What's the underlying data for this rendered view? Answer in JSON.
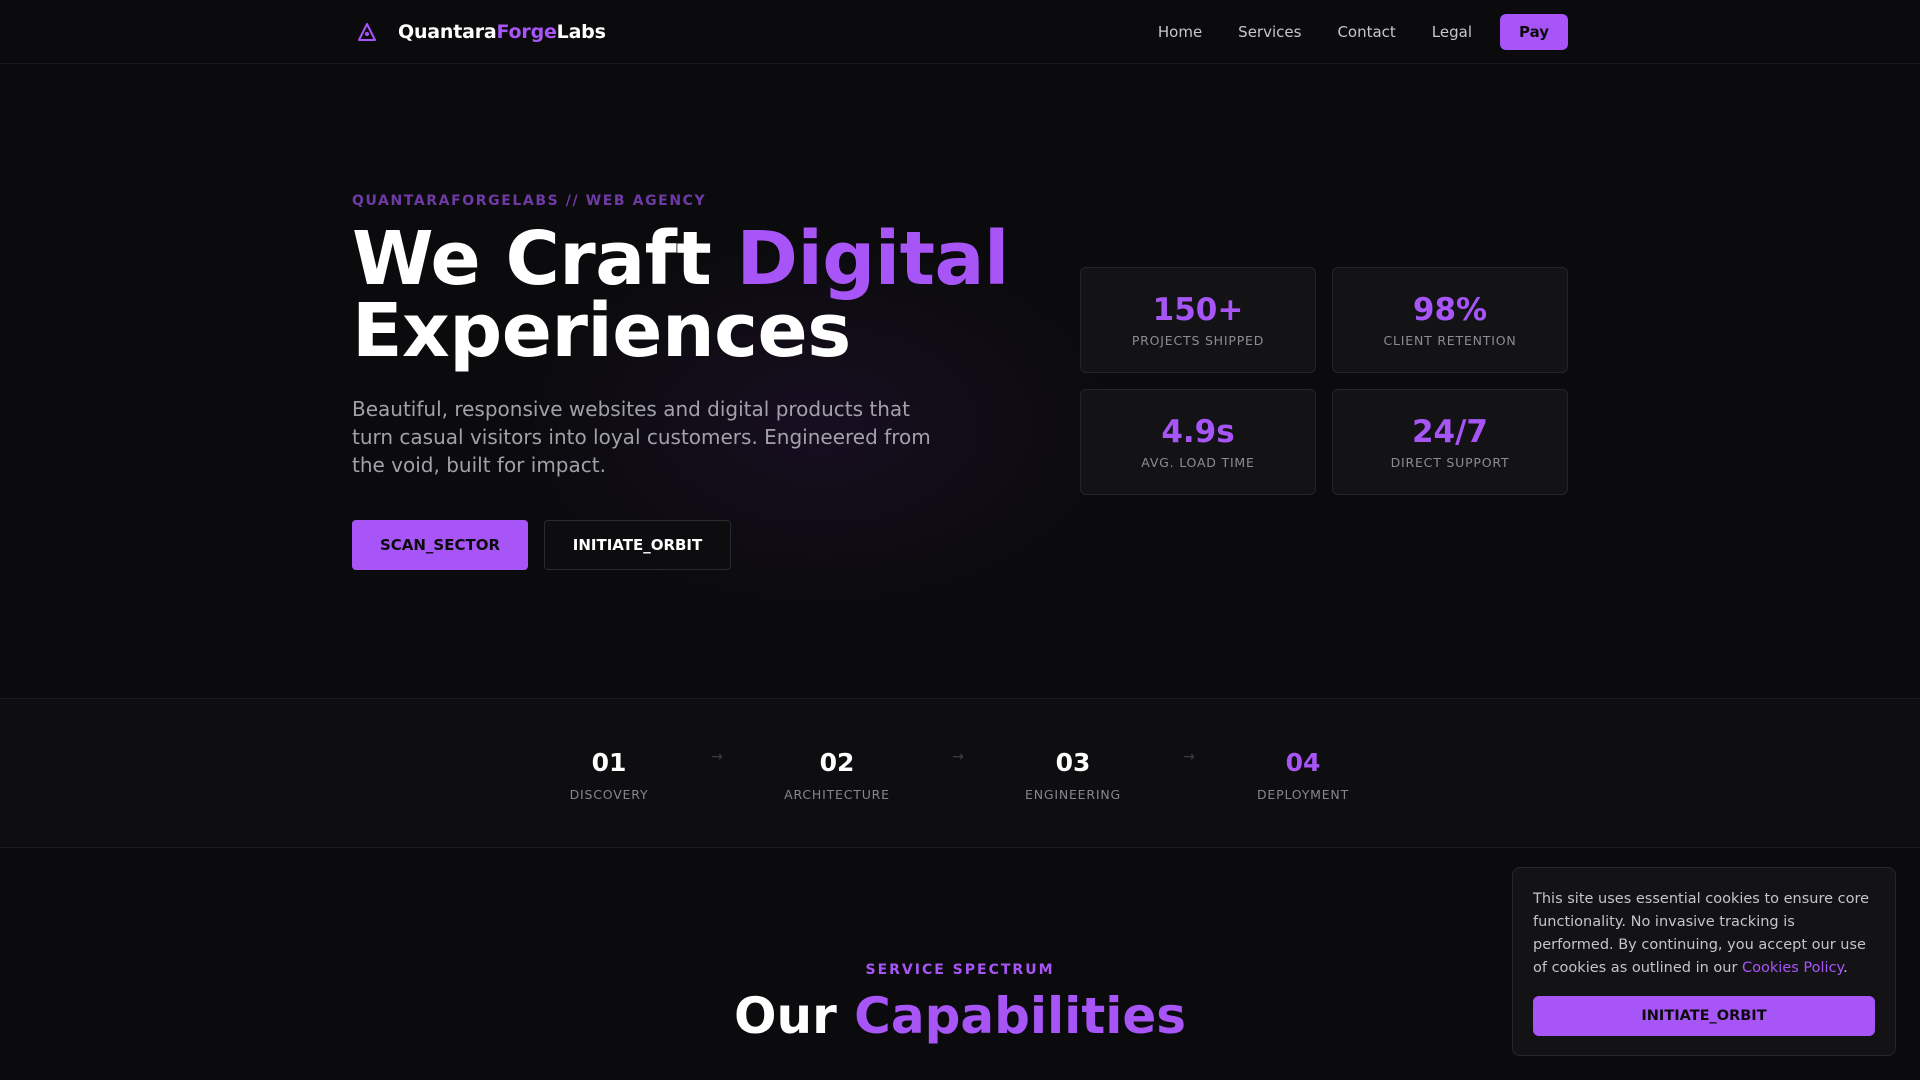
{
  "nav": {
    "brand": {
      "part1": "Quantara",
      "part2": "Forge",
      "part3": "Labs",
      "logo_icon": "triangle-logo-icon"
    },
    "links": [
      "Home",
      "Services",
      "Contact",
      "Legal"
    ],
    "cta_label": "Pay"
  },
  "hero": {
    "eyebrow": "QUANTARAFORGELABS // WEB AGENCY",
    "headline_line1_plain": "We Craft ",
    "headline_line1_accent": "Digital",
    "headline_line2": "Experiences",
    "subtext": "Beautiful, responsive websites and digital products that turn casual visitors into loyal customers. Engineered from the void, built for impact.",
    "primary_button": "SCAN_SECTOR",
    "secondary_button": "INITIATE_ORBIT",
    "stats": [
      {
        "value": "150+",
        "label": "PROJECTS SHIPPED"
      },
      {
        "value": "98%",
        "label": "CLIENT RETENTION"
      },
      {
        "value": "4.9s",
        "label": "AVG. LOAD TIME"
      },
      {
        "value": "24/7",
        "label": "DIRECT SUPPORT"
      }
    ]
  },
  "process": {
    "steps": [
      {
        "number": "01",
        "label": "DISCOVERY"
      },
      {
        "number": "02",
        "label": "ARCHITECTURE"
      },
      {
        "number": "03",
        "label": "ENGINEERING"
      },
      {
        "number": "04",
        "label": "DEPLOYMENT"
      }
    ],
    "arrow": "→"
  },
  "services": {
    "eyebrow": "SERVICE SPECTRUM",
    "title_plain": "Our ",
    "title_accent": "Capabilities"
  },
  "cookie": {
    "text_before_link": "This site uses essential cookies to ensure core functionality. No invasive tracking is performed. By continuing, you accept our use of cookies as outlined in our ",
    "link_text": "Cookies Policy",
    "text_after_link": ".",
    "button_label": "INITIATE_ORBIT"
  },
  "colors": {
    "background": "#0b0b0d",
    "accent": "#a855f7",
    "card": "#131316",
    "muted_text": "#a1a1aa"
  }
}
